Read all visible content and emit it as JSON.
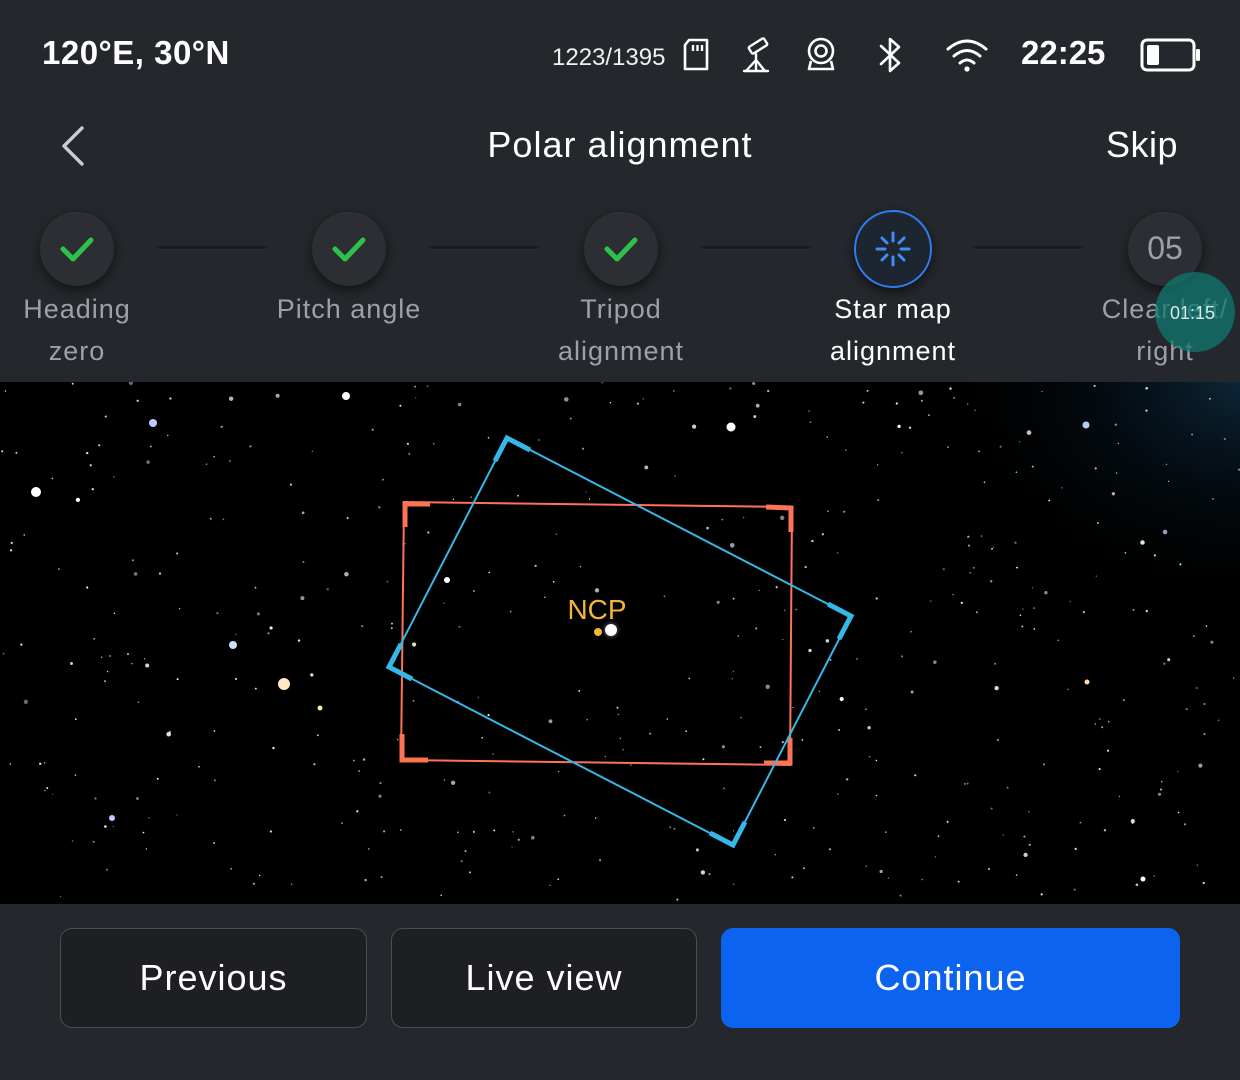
{
  "status_bar": {
    "coordinates": "120°E, 30°N",
    "storage": "1223/1395",
    "time": "22:25",
    "icons": [
      "sd-card-icon",
      "telescope-icon",
      "webcam-icon",
      "bluetooth-icon",
      "wifi-icon",
      "battery-icon"
    ],
    "battery_level": 0.25
  },
  "header": {
    "title": "Polar alignment",
    "skip_label": "Skip"
  },
  "steps": [
    {
      "label": "Heading\nzero",
      "state": "done"
    },
    {
      "label": "Pitch angle",
      "state": "done"
    },
    {
      "label": "Tripod\nalignment",
      "state": "done"
    },
    {
      "label": "Star map\nalignment",
      "state": "active"
    },
    {
      "number": "05",
      "label": "Clear left/\nright",
      "state": "pending"
    }
  ],
  "timer": "01:15",
  "skymap": {
    "target_label": "NCP"
  },
  "footer": {
    "previous_label": "Previous",
    "live_view_label": "Live view",
    "continue_label": "Continue"
  },
  "colors": {
    "background": "#24272b",
    "accent_blue": "#0b63f0",
    "check_green": "#2fc24a",
    "frame_orange": "#ff7355",
    "frame_cyan": "#35b8e8",
    "ncp_label": "#f2b53a"
  }
}
